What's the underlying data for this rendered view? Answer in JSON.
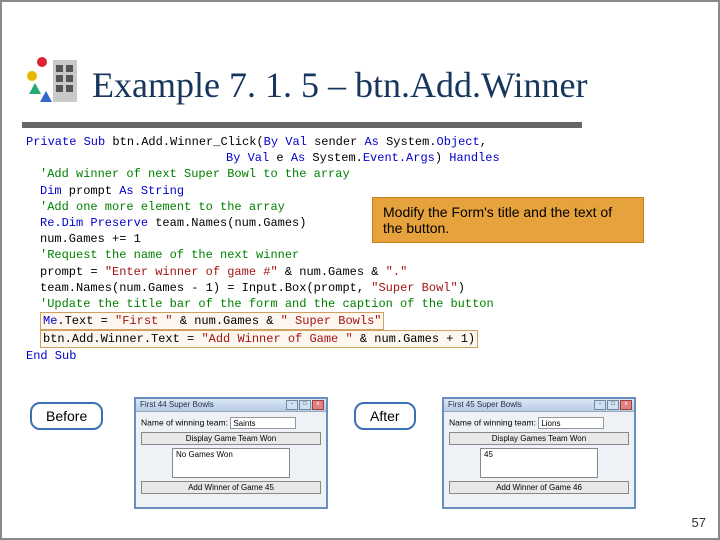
{
  "title": "Example 7. 1. 5 – btn.Add.Winner",
  "annotation": "Modify the Form's title and the text of the button.",
  "labels": {
    "before": "Before",
    "after": "After"
  },
  "page_number": "57",
  "code": {
    "l1a": "Private Sub",
    "l1b": " btn.Add.Winner_Click(",
    "l1c": "By Val",
    "l1d": " sender ",
    "l1e": "As",
    "l1f": " System.",
    "l1g": "Object",
    "l2a": "By Val",
    "l2b": " e ",
    "l2c": "As",
    "l2d": " System.",
    "l2e": "Event.Args",
    "l2f": ") ",
    "l2g": "Handles",
    "c1": "'Add winner of next Super Bowl to the array",
    "l3a": "Dim",
    "l3b": " prompt ",
    "l3c": "As String",
    "c2": "'Add one more element to the array",
    "l4a": "Re.Dim Preserve",
    "l4b": " team.Names(num.Games)",
    "l5": "num.Games += 1",
    "c3": "'Request the name of the next winner",
    "l6a": "prompt = ",
    "l6b": "\"Enter winner of game #\"",
    "l6c": " & num.Games & ",
    "l6d": "\".\"",
    "l7a": "team.Names(num.Games - 1) = Input.Box(prompt, ",
    "l7b": "\"Super Bowl\"",
    "l7c": ")",
    "c4": "'Update the title bar of the form and the caption of the button",
    "l8a": "Me",
    "l8b": ".Text = ",
    "l8c": "\"First \"",
    "l8d": " & num.Games & ",
    "l8e": "\" Super Bowls\"",
    "l9a": "btn.Add.Winner.Text = ",
    "l9b": "\"Add Winner of Game \"",
    "l9c": " & num.Games + 1)",
    "l10": "End Sub"
  },
  "win_before": {
    "title": "First 44 Super Bowls",
    "field_label": "Name of winning team:",
    "field_value": "Saints",
    "btn1": "Display Game Team Won",
    "list": "No Games Won",
    "btn2": "Add Winner of Game 45"
  },
  "win_after": {
    "title": "First 45 Super Bowls",
    "field_label": "Name of winning team:",
    "field_value": "Lions",
    "btn1": "Display Games Team Won",
    "list": "45",
    "btn2": "Add Winner of Game 46"
  }
}
